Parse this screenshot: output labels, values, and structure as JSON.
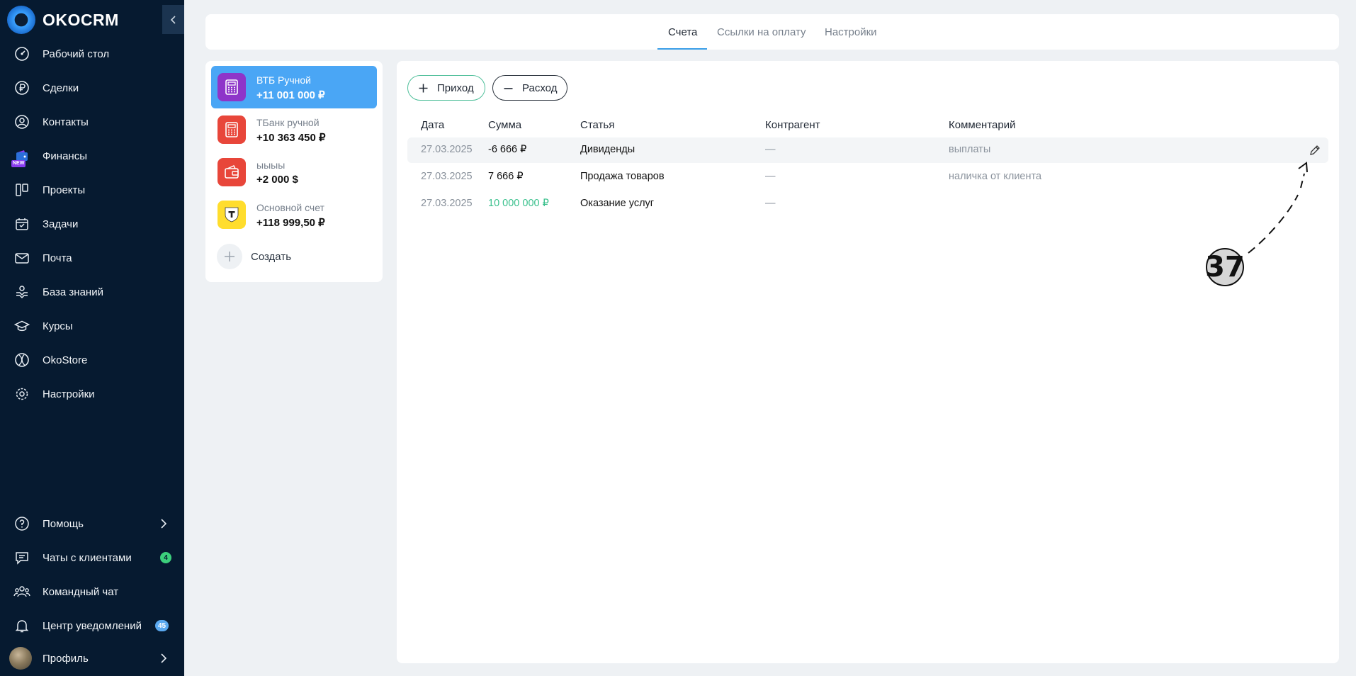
{
  "app": {
    "name": "OKOCRM"
  },
  "sidebar": {
    "items": [
      {
        "label": "Рабочий стол",
        "icon": "dashboard-icon"
      },
      {
        "label": "Сделки",
        "icon": "ruble-icon"
      },
      {
        "label": "Контакты",
        "icon": "contact-icon"
      },
      {
        "label": "Финансы",
        "icon": "finance-icon",
        "badge": "NEW"
      },
      {
        "label": "Проекты",
        "icon": "projects-icon"
      },
      {
        "label": "Задачи",
        "icon": "calendar-icon"
      },
      {
        "label": "Почта",
        "icon": "mail-icon"
      },
      {
        "label": "База знаний",
        "icon": "knowledge-icon"
      },
      {
        "label": "Курсы",
        "icon": "graduation-cap-icon"
      },
      {
        "label": "OkoStore",
        "icon": "store-icon"
      },
      {
        "label": "Настройки",
        "icon": "gear-icon"
      }
    ],
    "bottom": [
      {
        "label": "Помощь",
        "icon": "help-icon"
      },
      {
        "label": "Чаты с клиентами",
        "icon": "chat-icon",
        "count": "4",
        "count_color": "#3ccf7c"
      },
      {
        "label": "Командный чат",
        "icon": "team-icon"
      },
      {
        "label": "Центр уведомлений",
        "icon": "bell-icon",
        "count": "45",
        "count_color": "#5aa9f0"
      },
      {
        "label": "Профиль",
        "icon": "avatar"
      }
    ]
  },
  "tabs": [
    {
      "label": "Счета",
      "active": true
    },
    {
      "label": "Ссылки на оплату",
      "active": false
    },
    {
      "label": "Настройки",
      "active": false
    }
  ],
  "accounts": [
    {
      "name": "ВТБ Ручной",
      "balance": "+11 001 000 ₽",
      "icon": "calculator-icon",
      "color": "#8e35c9",
      "selected": true
    },
    {
      "name": "ТБанк ручной",
      "balance": "+10 363 450 ₽",
      "icon": "calculator-icon",
      "color": "#e8463a",
      "selected": false
    },
    {
      "name": "ыыыы",
      "balance": "+2 000 $",
      "icon": "wallet-icon",
      "color": "#e8463a",
      "selected": false
    },
    {
      "name": "Основной счет",
      "balance": "+118 999,50 ₽",
      "icon": "tbank-logo-icon",
      "color": "#ffdd2d",
      "selected": false
    }
  ],
  "create_label": "Создать",
  "actions": {
    "income": "Приход",
    "expense": "Расход"
  },
  "table": {
    "headers": [
      "Дата",
      "Сумма",
      "Статья",
      "Контрагент",
      "Комментарий"
    ],
    "rows": [
      {
        "date": "27.03.2025",
        "sum": "-6 666 ₽",
        "article": "Дивиденды",
        "counterparty": "—",
        "comment": "выплаты",
        "sum_color": "#111111"
      },
      {
        "date": "27.03.2025",
        "sum": "7 666 ₽",
        "article": "Продажа товаров",
        "counterparty": "—",
        "comment": "наличка от клиента",
        "sum_color": "#111111"
      },
      {
        "date": "27.03.2025",
        "sum": "10 000 000 ₽",
        "article": "Оказание услуг",
        "counterparty": "—",
        "comment": "",
        "sum_color": "#3cc18e"
      }
    ]
  },
  "annotation": {
    "number": "37"
  },
  "colors": {
    "sidebar_bg": "#061a30",
    "accent": "#4aa6f5",
    "income_border": "#4fbf9a"
  }
}
